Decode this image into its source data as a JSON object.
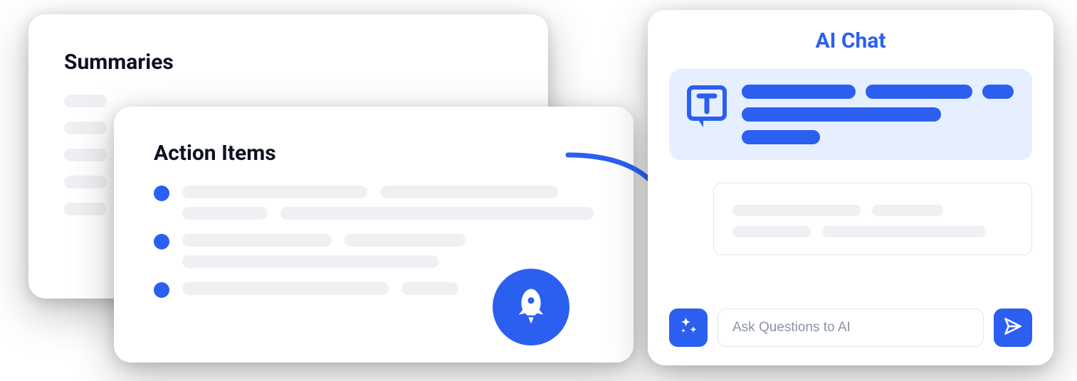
{
  "summaries": {
    "title": "Summaries"
  },
  "actions": {
    "title": "Action Items"
  },
  "ai_chat": {
    "title": "AI Chat",
    "input_placeholder": "Ask Questions to AI"
  },
  "icons": {
    "rocket": "rocket-icon",
    "sparkle": "sparkle-icon",
    "send": "send-icon",
    "logo": "t-logo-icon",
    "arrow": "curved-arrow-icon"
  },
  "colors": {
    "accent": "#2b5ff0",
    "placeholder_bar": "#eef0f3",
    "bubble_bg": "#e6efff"
  }
}
